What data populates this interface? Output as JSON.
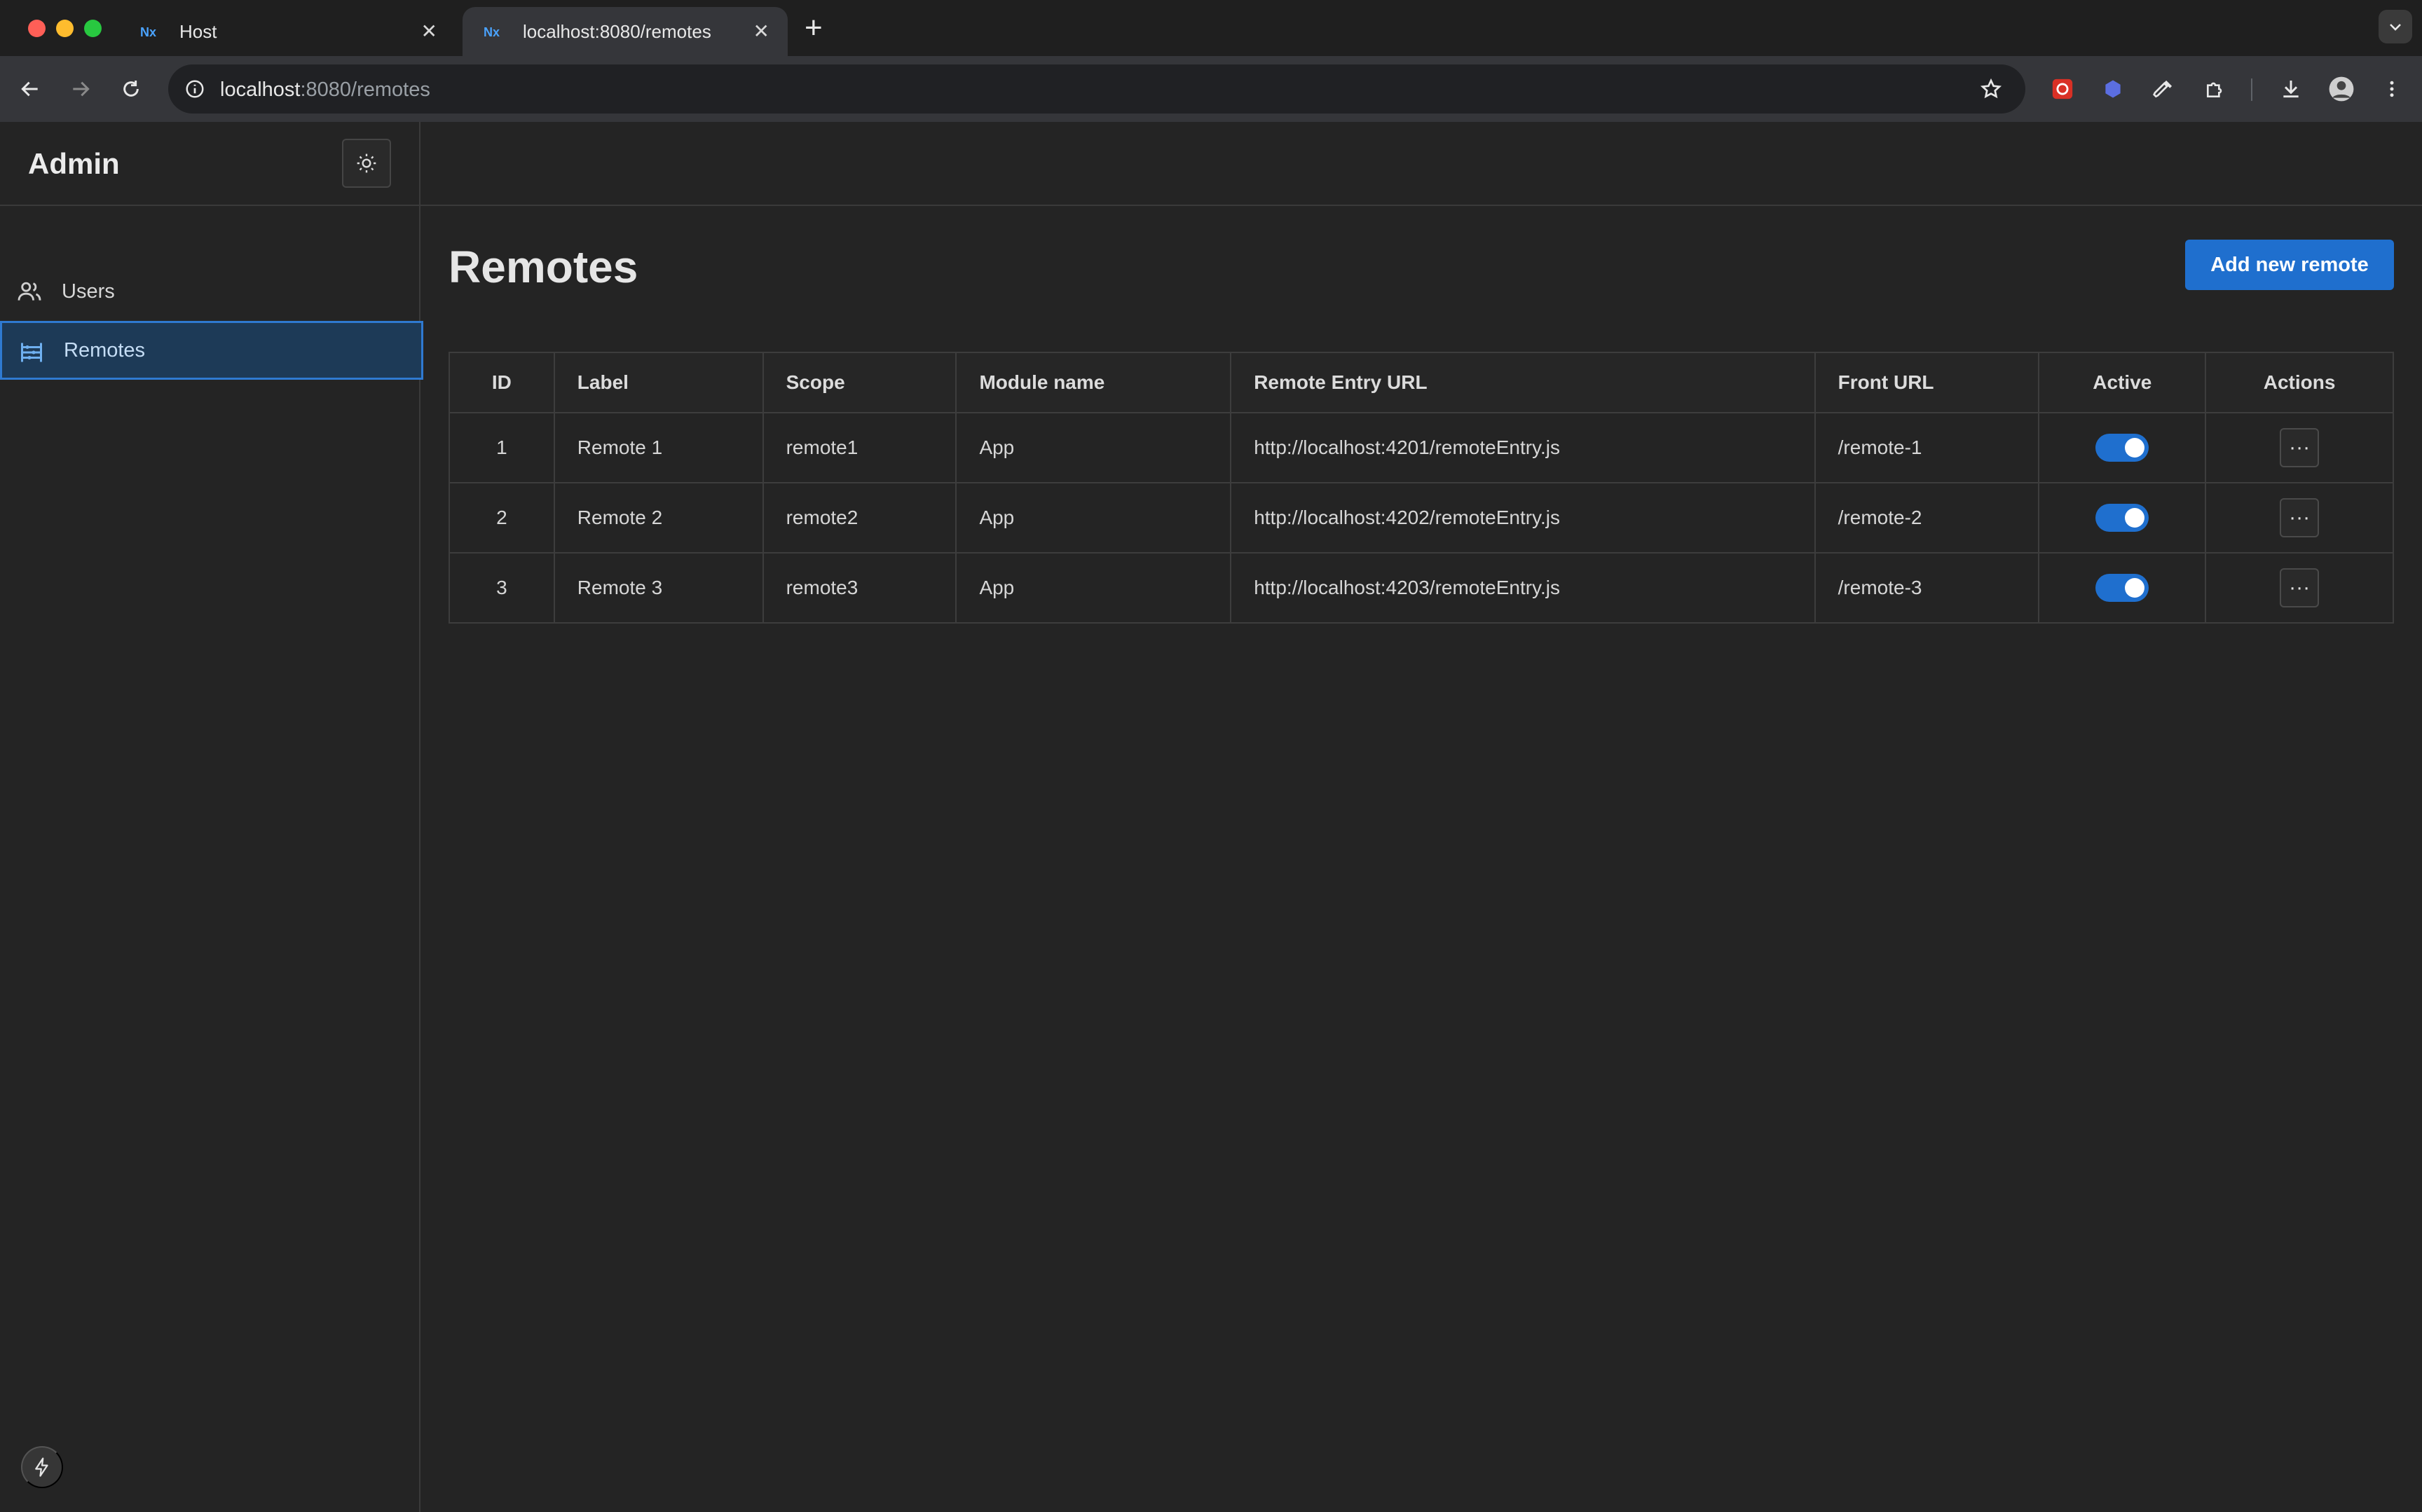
{
  "browser": {
    "tabs": [
      {
        "title": "Host",
        "close": "✕"
      },
      {
        "title": "localhost:8080/remotes",
        "close": "✕"
      }
    ],
    "new_tab": "+",
    "url_host": "localhost",
    "url_path": ":8080/remotes"
  },
  "sidebar": {
    "brand": "Admin",
    "items": [
      {
        "label": "Users",
        "icon": "users-icon",
        "active": false
      },
      {
        "label": "Remotes",
        "icon": "abacus-icon",
        "active": true
      }
    ]
  },
  "page": {
    "title": "Remotes",
    "add_button": "Add new remote"
  },
  "table": {
    "headers": [
      "ID",
      "Label",
      "Scope",
      "Module name",
      "Remote Entry URL",
      "Front URL",
      "Active",
      "Actions"
    ],
    "rows": [
      {
        "id": "1",
        "label": "Remote 1",
        "scope": "remote1",
        "module": "App",
        "entry_url": "http://localhost:4201/remoteEntry.js",
        "front_url": "/remote-1",
        "active": true,
        "actions": "···"
      },
      {
        "id": "2",
        "label": "Remote 2",
        "scope": "remote2",
        "module": "App",
        "entry_url": "http://localhost:4202/remoteEntry.js",
        "front_url": "/remote-2",
        "active": true,
        "actions": "···"
      },
      {
        "id": "3",
        "label": "Remote 3",
        "scope": "remote3",
        "module": "App",
        "entry_url": "http://localhost:4203/remoteEntry.js",
        "front_url": "/remote-3",
        "active": true,
        "actions": "···"
      }
    ]
  },
  "colors": {
    "accent": "#1f6fce",
    "background": "#242424",
    "active_nav_bg": "#1d3a57"
  }
}
